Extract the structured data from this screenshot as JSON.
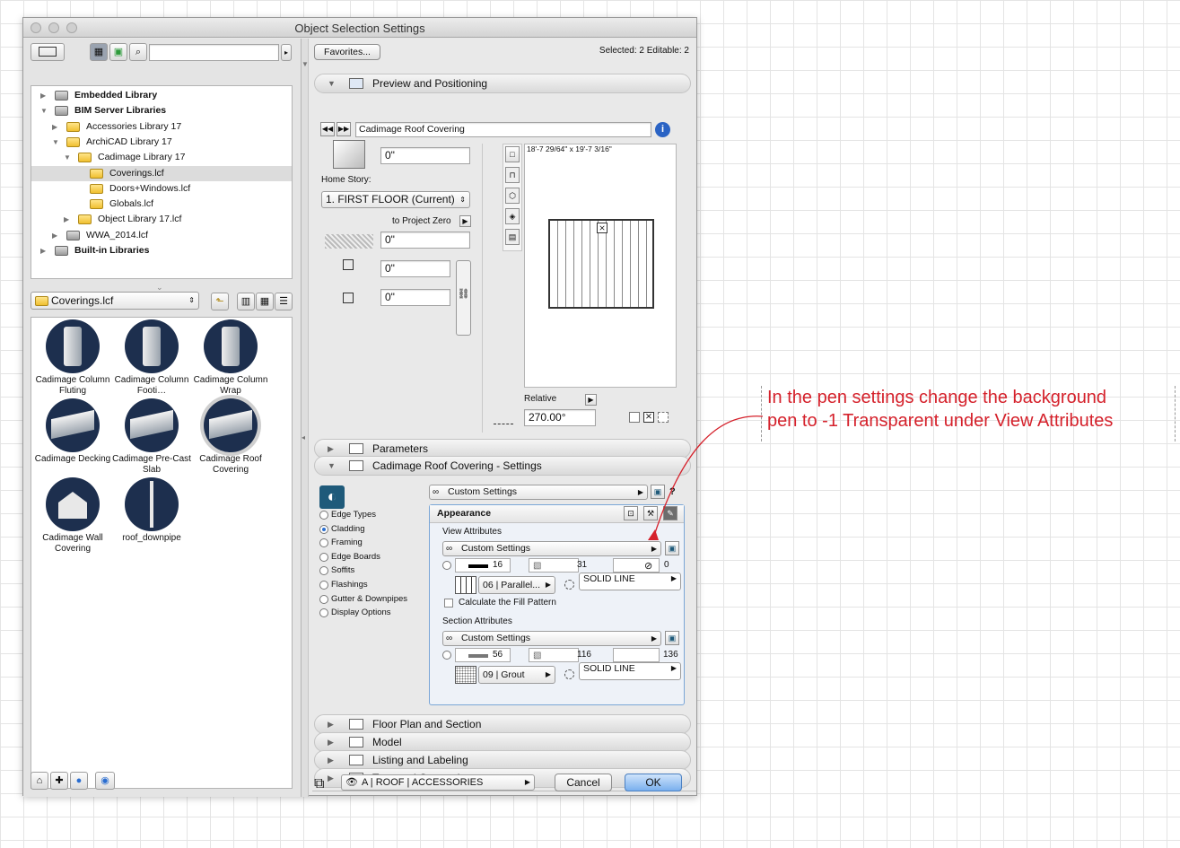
{
  "window": {
    "title": "Object Selection Settings"
  },
  "left": {
    "tree": [
      {
        "label": "Embedded Library",
        "indent": 0,
        "expanded": false,
        "bold": true,
        "icon": "library-icon"
      },
      {
        "label": "BIM Server Libraries",
        "indent": 0,
        "expanded": true,
        "bold": true,
        "icon": "server-library-icon"
      },
      {
        "label": "Accessories Library 17",
        "indent": 1,
        "expanded": false,
        "icon": "folder-icon"
      },
      {
        "label": "ArchiCAD Library 17",
        "indent": 1,
        "expanded": true,
        "icon": "folder-icon"
      },
      {
        "label": "Cadimage Library 17",
        "indent": 2,
        "expanded": true,
        "icon": "folder-icon"
      },
      {
        "label": "Coverings.lcf",
        "indent": 3,
        "selected": true,
        "icon": "folder-icon"
      },
      {
        "label": "Doors+Windows.lcf",
        "indent": 3,
        "icon": "folder-icon"
      },
      {
        "label": "Globals.lcf",
        "indent": 3,
        "icon": "folder-icon"
      },
      {
        "label": "Object Library 17.lcf",
        "indent": 2,
        "expanded": false,
        "icon": "folder-icon"
      },
      {
        "label": "WWA_2014.lcf",
        "indent": 1,
        "expanded": false,
        "icon": "file-icon"
      },
      {
        "label": "Built-in Libraries",
        "indent": 0,
        "expanded": false,
        "bold": true,
        "icon": "library-icon"
      }
    ],
    "folder_popup": "Coverings.lcf",
    "objects": [
      {
        "label": "Cadimage Column Fluting",
        "icon": "column-fluting-icon"
      },
      {
        "label": "Cadimage Column Footi…",
        "icon": "column-footing-icon"
      },
      {
        "label": "Cadimage Column Wrap",
        "icon": "column-wrap-icon"
      },
      {
        "label": "Cadimage Decking",
        "icon": "decking-icon"
      },
      {
        "label": "Cadimage Pre-Cast Slab",
        "icon": "precast-slab-icon"
      },
      {
        "label": "Cadimage Roof Covering",
        "icon": "roof-covering-icon",
        "selected": true
      },
      {
        "label": "Cadimage Wall Covering",
        "icon": "wall-covering-icon"
      },
      {
        "label": "roof_downpipe",
        "icon": "downpipe-icon"
      }
    ]
  },
  "right": {
    "favorites": "Favorites...",
    "selected_info": "Selected: 2 Editable: 2",
    "sections": {
      "preview": "Preview and Positioning",
      "parameters": "Parameters",
      "settings": "Cadimage Roof Covering - Settings",
      "floorplan": "Floor Plan and Section",
      "model": "Model",
      "listing": "Listing and Labeling",
      "tags": "Tags and Categories"
    },
    "object_name": "Cadimage Roof Covering",
    "elevation": "0\"",
    "home_story_label": "Home Story:",
    "home_story": "1. FIRST FLOOR (Current)",
    "to_project_zero": "to Project Zero",
    "zero_value": "0\"",
    "width_value": "0\"",
    "depth_value": "0\"",
    "preview_size": "18'-7 29/64\" x 19'-7 3/16\"",
    "relative_label": "Relative",
    "angle": "270.00°",
    "custom_settings": "Custom Settings",
    "options": [
      {
        "label": "Edge Types",
        "on": false
      },
      {
        "label": "Cladding",
        "on": true
      },
      {
        "label": "Framing",
        "on": false
      },
      {
        "label": "Edge Boards",
        "on": false
      },
      {
        "label": "Soffits",
        "on": false
      },
      {
        "label": "Flashings",
        "on": false
      },
      {
        "label": "Gutter & Downpipes",
        "on": false
      },
      {
        "label": "Display Options",
        "on": false
      }
    ],
    "appearance": "Appearance",
    "view_attributes": "View Attributes",
    "view_custom": "Custom Settings",
    "view_pen1": "16",
    "view_pen2": "31",
    "view_pen3": "0",
    "view_fill": "06 | Parallel...",
    "view_line": "SOLID LINE",
    "calc_fill": "Calculate the Fill Pattern",
    "section_attributes": "Section Attributes",
    "section_custom": "Custom Settings",
    "sec_pen1": "56",
    "sec_pen2": "116",
    "sec_pen3": "136",
    "sec_fill": "09 | Grout",
    "sec_line": "SOLID LINE",
    "layer": "A | ROOF | ACCESSORIES",
    "cancel": "Cancel",
    "ok": "OK"
  },
  "annotation": {
    "line1": "In the pen settings change the background",
    "line2": "pen to -1 Transparent under View Attributes",
    "color": "#d5212b"
  }
}
